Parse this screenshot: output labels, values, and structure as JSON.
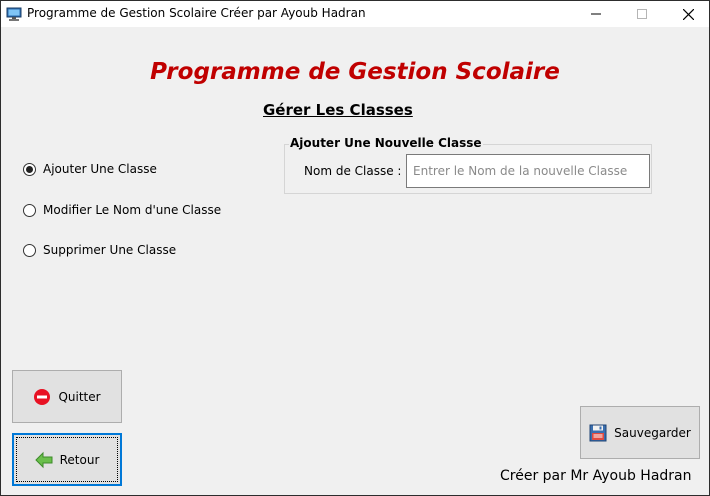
{
  "window": {
    "title": "Programme de Gestion Scolaire Créer par Ayoub Hadran",
    "controls": {
      "minimize": "—",
      "maximize": "☐",
      "close": "✕"
    }
  },
  "header": {
    "title": "Programme de Gestion Scolaire",
    "subtitle": "Gérer Les Classes"
  },
  "options": [
    {
      "label": "Ajouter Une Classe",
      "selected": true
    },
    {
      "label": "Modifier Le Nom d'une Classe",
      "selected": false
    },
    {
      "label": "Supprimer Une Classe",
      "selected": false
    }
  ],
  "form": {
    "group_title": "Ajouter Une Nouvelle Classe",
    "class_name_label": "Nom de Classe :",
    "class_name_value": "",
    "class_name_placeholder": "Entrer le Nom de la nouvelle Classe"
  },
  "buttons": {
    "quit": "Quitter",
    "back": "Retour",
    "save": "Sauvegarder"
  },
  "icons": {
    "app": "monitor-icon",
    "quit": "no-entry-icon",
    "back": "left-arrow-icon",
    "save": "floppy-disk-icon"
  },
  "footer": {
    "credit": "Créer par Mr Ayoub Hadran"
  },
  "colors": {
    "title_red": "#c00000",
    "focus_blue": "#0078d7",
    "quit_red": "#e81123",
    "back_green": "#4caf50"
  }
}
